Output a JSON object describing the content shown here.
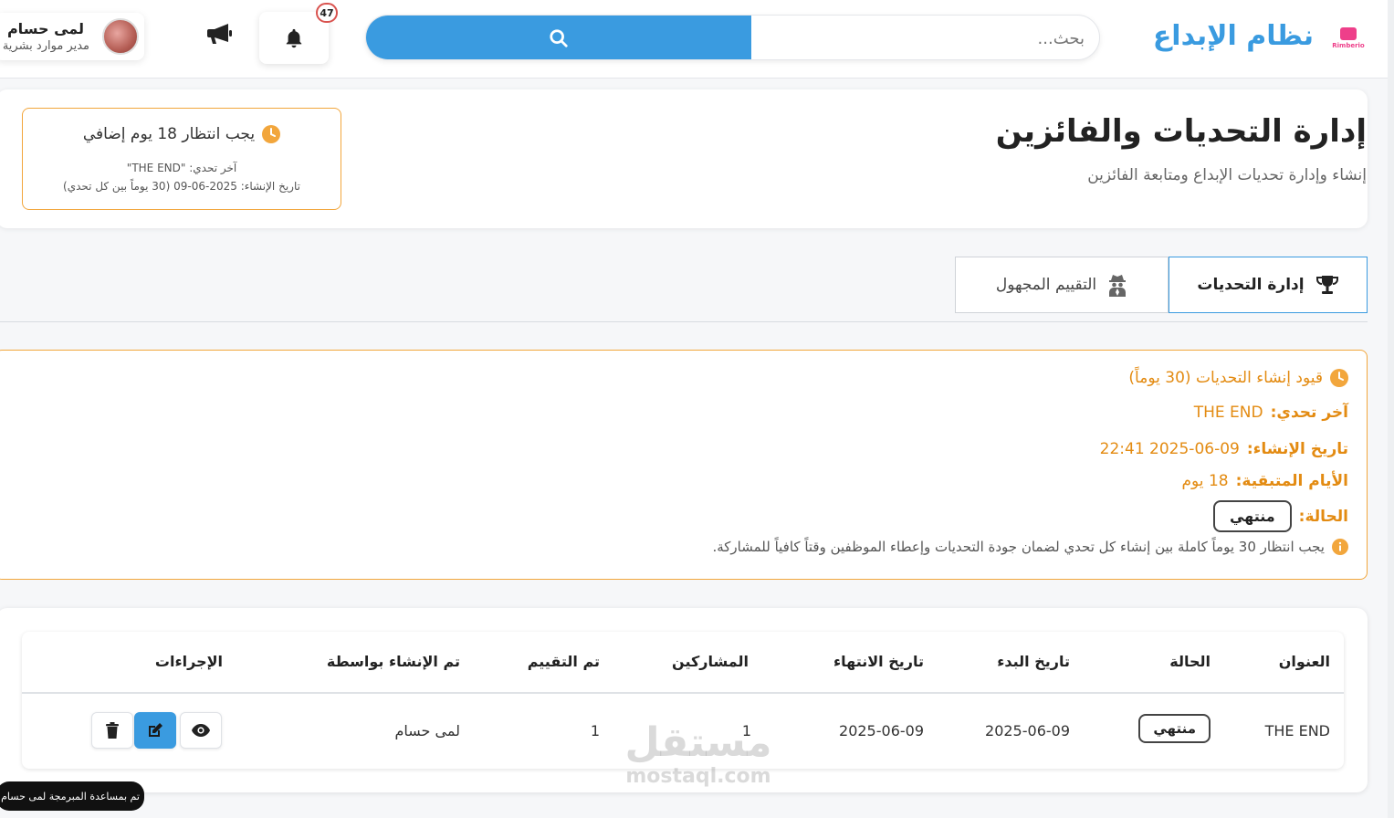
{
  "header": {
    "app_title": "نظام الإبداع",
    "logo_text": "Rimberio",
    "search_placeholder": "بحث...",
    "notification_count": "47",
    "user": {
      "name": "لمى حسام",
      "role": "مدير موارد بشرية"
    }
  },
  "page": {
    "title": "إدارة التحديات والفائزين",
    "subtitle": "إنشاء وإدارة تحديات الإبداع ومتابعة الفائزين"
  },
  "wait_card": {
    "message": "يجب انتظار 18 يوم إضافي",
    "last_challenge": "آخر تحدي: \"THE END\"",
    "created": "تاريخ الإنشاء: 2025-06-09 (30 يوماً بين كل تحدي)"
  },
  "tabs": [
    {
      "label": "إدارة التحديات",
      "icon": "trophy-icon",
      "active": true
    },
    {
      "label": "التقييم المجهول",
      "icon": "user-secret-icon",
      "active": false
    }
  ],
  "constraints": {
    "title": "قيود إنشاء التحديات (30 يوماً)",
    "last_label": "آخر تحدي:",
    "last_value": "THE END",
    "created_label": "تاريخ الإنشاء:",
    "created_value": "2025-06-09 22:41",
    "remaining_label": "الأيام المتبقية:",
    "remaining_value": "18 يوم",
    "status_label": "الحالة:",
    "status_value": "منتهي",
    "note": "يجب انتظار 30 يوماً كاملة بين إنشاء كل تحدي لضمان جودة التحديات وإعطاء الموظفين وقتاً كافياً للمشاركة."
  },
  "table": {
    "headers": [
      "العنوان",
      "الحالة",
      "تاريخ البدء",
      "تاريخ الانتهاء",
      "المشاركين",
      "تم التقييم",
      "تم الإنشاء بواسطة",
      "الإجراءات"
    ],
    "rows": [
      {
        "title": "THE END",
        "status": "منتهي",
        "start": "2025-06-09",
        "end": "2025-06-09",
        "participants": "1",
        "evaluated": "1",
        "created_by": "لمى حسام"
      }
    ]
  },
  "watermark": {
    "ar": "مستقل",
    "en": "mostaql.com"
  },
  "credit": "تم بمساعدة المبرمجة لمى حسام",
  "colors": {
    "primary": "#3a9be0",
    "warning": "#e38b12",
    "warning_border": "#f2a63c",
    "brand_pink": "#ee3f8a"
  }
}
